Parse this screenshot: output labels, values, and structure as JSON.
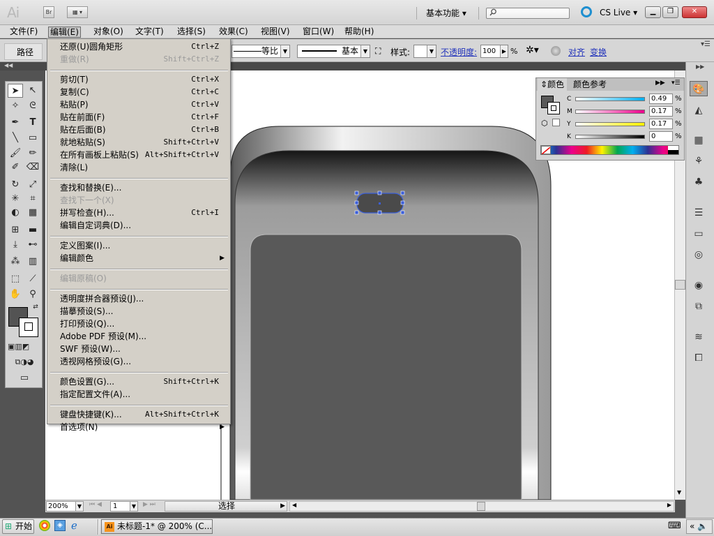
{
  "titlebar": {
    "logo": "Ai",
    "br_label": "Br",
    "workspace_label": "基本功能",
    "cs_live_label": "CS Live",
    "search_placeholder": ""
  },
  "menubar": {
    "items": [
      "文件(F)",
      "编辑(E)",
      "对象(O)",
      "文字(T)",
      "选择(S)",
      "效果(C)",
      "视图(V)",
      "窗口(W)",
      "帮助(H)"
    ],
    "active_index": 1
  },
  "controlbar": {
    "object_type": "路径",
    "stroke_profile": "等比",
    "brush": "基本",
    "style_label": "样式:",
    "opacity_label": "不透明度:",
    "opacity_value": "100",
    "opacity_unit": "%",
    "align_label": "对齐",
    "transform_label": "变换"
  },
  "edit_menu": {
    "items": [
      {
        "label": "还原(U)圆角矩形",
        "shortcut": "Ctrl+Z",
        "disabled": false
      },
      {
        "label": "重做(R)",
        "shortcut": "Shift+Ctrl+Z",
        "disabled": true
      },
      {
        "sep": true
      },
      {
        "label": "剪切(T)",
        "shortcut": "Ctrl+X",
        "disabled": false
      },
      {
        "label": "复制(C)",
        "shortcut": "Ctrl+C",
        "disabled": false
      },
      {
        "label": "粘贴(P)",
        "shortcut": "Ctrl+V",
        "disabled": false
      },
      {
        "label": "贴在前面(F)",
        "shortcut": "Ctrl+F",
        "disabled": false
      },
      {
        "label": "贴在后面(B)",
        "shortcut": "Ctrl+B",
        "disabled": false
      },
      {
        "label": "就地粘贴(S)",
        "shortcut": "Shift+Ctrl+V",
        "disabled": false
      },
      {
        "label": "在所有画板上粘贴(S)",
        "shortcut": "Alt+Shift+Ctrl+V",
        "disabled": false
      },
      {
        "label": "清除(L)",
        "shortcut": "",
        "disabled": false
      },
      {
        "sep": true
      },
      {
        "label": "查找和替换(E)...",
        "shortcut": "",
        "disabled": false
      },
      {
        "label": "查找下一个(X)",
        "shortcut": "",
        "disabled": true
      },
      {
        "label": "拼写检查(H)...",
        "shortcut": "Ctrl+I",
        "disabled": false
      },
      {
        "label": "编辑自定词典(D)...",
        "shortcut": "",
        "disabled": false
      },
      {
        "sep": true
      },
      {
        "label": "定义图案(I)...",
        "shortcut": "",
        "disabled": false
      },
      {
        "label": "编辑颜色",
        "shortcut": "",
        "disabled": false,
        "submenu": true
      },
      {
        "sep": true
      },
      {
        "label": "编辑原稿(O)",
        "shortcut": "",
        "disabled": true
      },
      {
        "sep": true
      },
      {
        "label": "透明度拼合器预设(J)...",
        "shortcut": "",
        "disabled": false
      },
      {
        "label": "描摹预设(S)...",
        "shortcut": "",
        "disabled": false
      },
      {
        "label": "打印预设(Q)...",
        "shortcut": "",
        "disabled": false
      },
      {
        "label": "Adobe PDF 预设(M)...",
        "shortcut": "",
        "disabled": false
      },
      {
        "label": "SWF 预设(W)...",
        "shortcut": "",
        "disabled": false
      },
      {
        "label": "透视网格预设(G)...",
        "shortcut": "",
        "disabled": false
      },
      {
        "sep": true
      },
      {
        "label": "颜色设置(G)...",
        "shortcut": "Shift+Ctrl+K",
        "disabled": false
      },
      {
        "label": "指定配置文件(A)...",
        "shortcut": "",
        "disabled": false
      },
      {
        "sep": true
      },
      {
        "label": "键盘快捷键(K)...",
        "shortcut": "Alt+Shift+Ctrl+K",
        "disabled": false
      },
      {
        "label": "首选项(N)",
        "shortcut": "",
        "disabled": false,
        "submenu": true
      }
    ]
  },
  "color_panel": {
    "tab_color": "颜色",
    "tab_guide": "颜色参考",
    "sliders": [
      {
        "label": "C",
        "value": "0.49",
        "unit": "%"
      },
      {
        "label": "M",
        "value": "0.17",
        "unit": "%"
      },
      {
        "label": "Y",
        "value": "0.17",
        "unit": "%"
      },
      {
        "label": "K",
        "value": "0",
        "unit": "%"
      }
    ]
  },
  "statusbar": {
    "zoom": "200%",
    "artboard": "1",
    "tool_label": "选择"
  },
  "taskbar": {
    "start_label": "开始",
    "task_label": "未标题-1* @ 200% (C..."
  },
  "colors": {
    "ui_dark": "#535353",
    "menu_bg": "#d4d0c8",
    "artwork_fill": "#595959",
    "selection": "#3c5fd8"
  }
}
